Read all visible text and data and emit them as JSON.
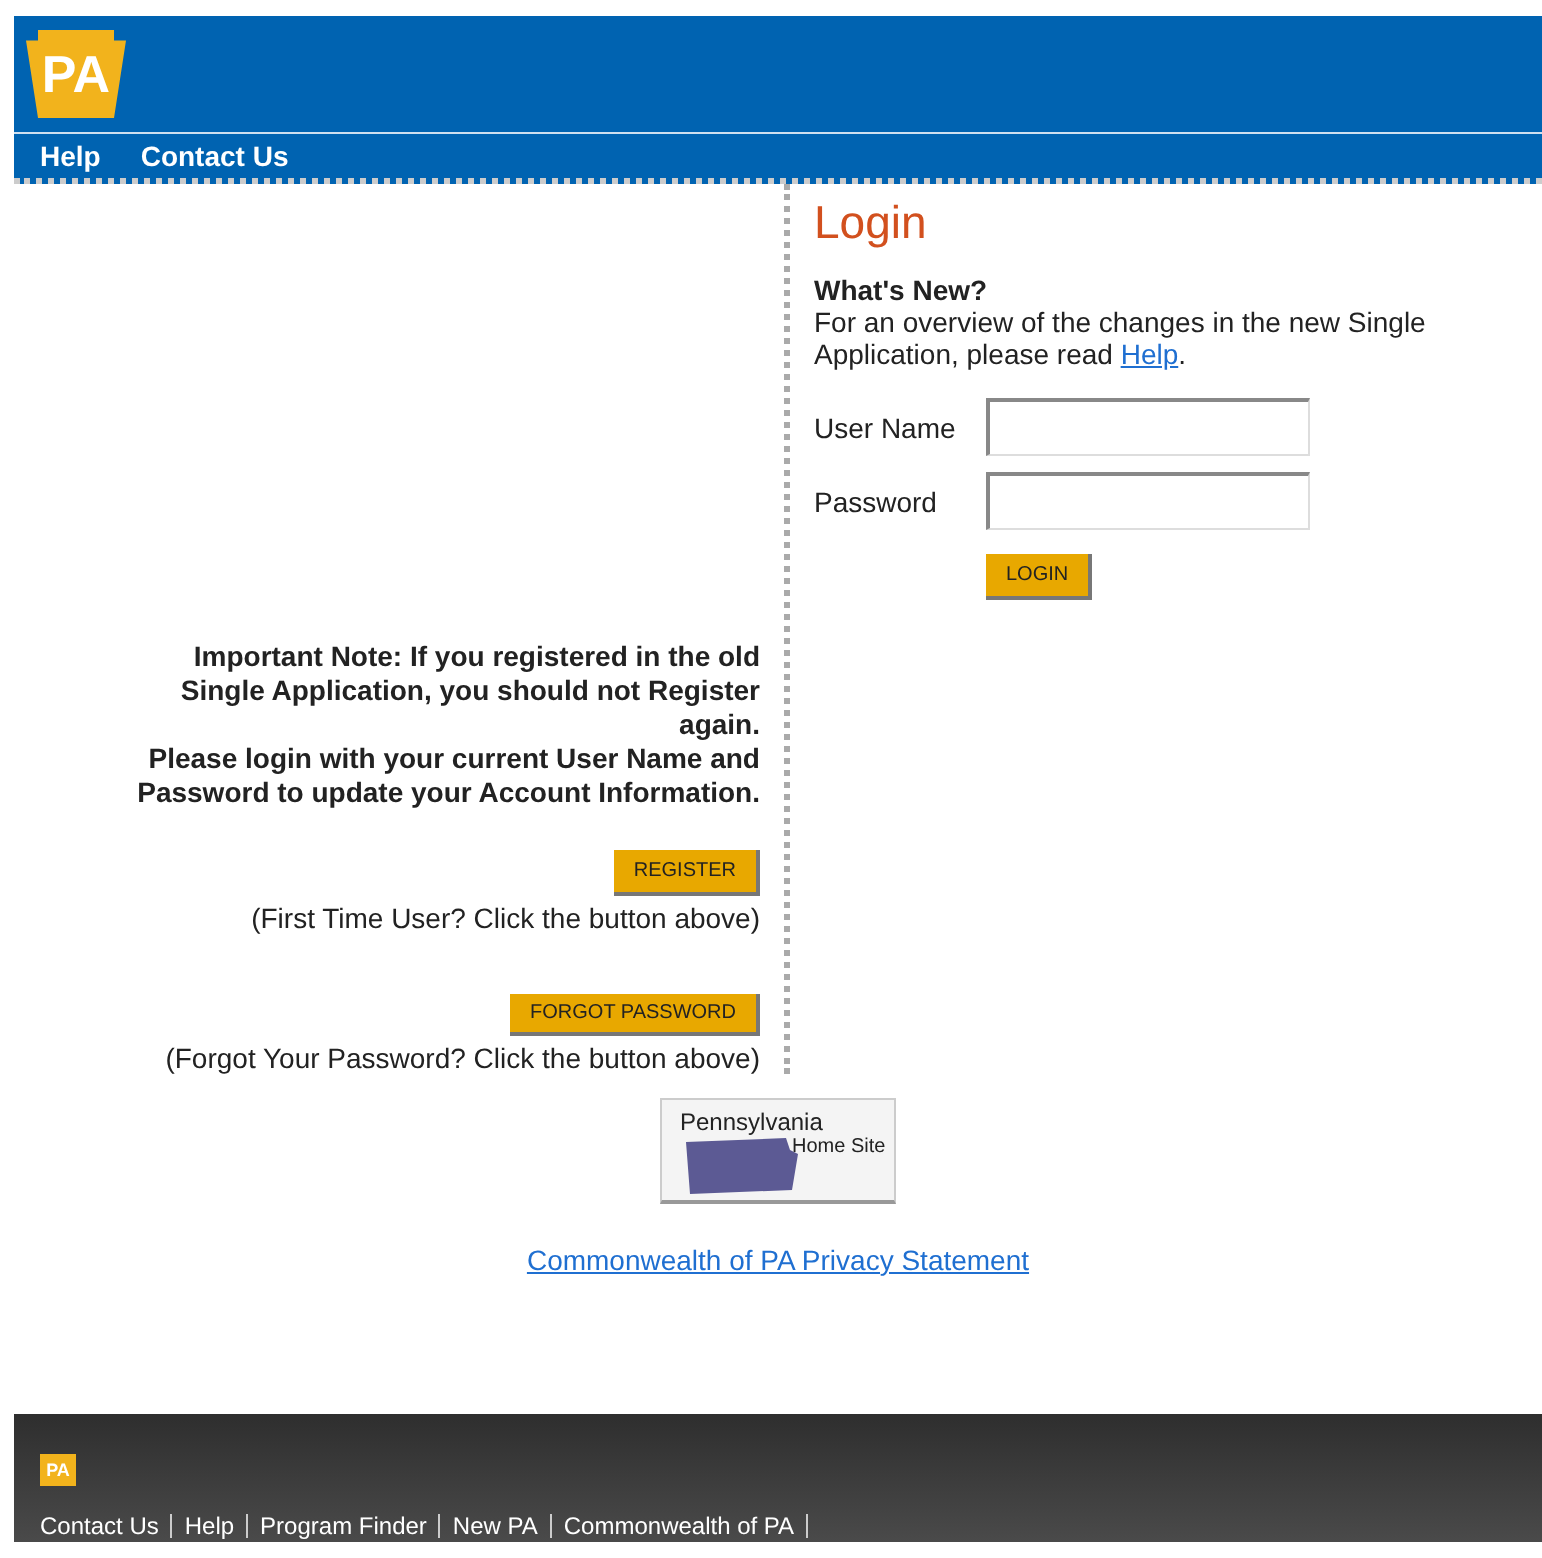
{
  "header": {
    "logo_text": "PA"
  },
  "nav": [
    {
      "label": "Help"
    },
    {
      "label": "Contact Us"
    }
  ],
  "left": {
    "note_lines": [
      "Important Note: If you registered in the old Single Application, you should not Register again.",
      "Please login with your current User Name and Password to update your Account Information."
    ],
    "register_button": "REGISTER",
    "register_hint": "(First Time User? Click the button above)",
    "forgot_button": "FORGOT PASSWORD",
    "forgot_hint": "(Forgot Your Password? Click the button above)"
  },
  "login": {
    "title": "Login",
    "whats_new_title": "What's New?",
    "whats_new_text": "For an overview of the changes in the new Single Application, please read",
    "whats_new_link": "Help",
    "whats_new_end": ".",
    "fields": [
      {
        "label": "User Name"
      },
      {
        "label": "Password"
      }
    ],
    "button": "LOGIN"
  },
  "home_site_banner": {
    "line1": "Pennsylvania",
    "line2": "Home Site"
  },
  "privacy_link": "Commonwealth of PA Privacy Statement",
  "footer": {
    "logo_text": "PA",
    "links": [
      "Contact Us",
      "Help",
      "Program Finder",
      "New PA",
      "Commonwealth of PA"
    ]
  }
}
